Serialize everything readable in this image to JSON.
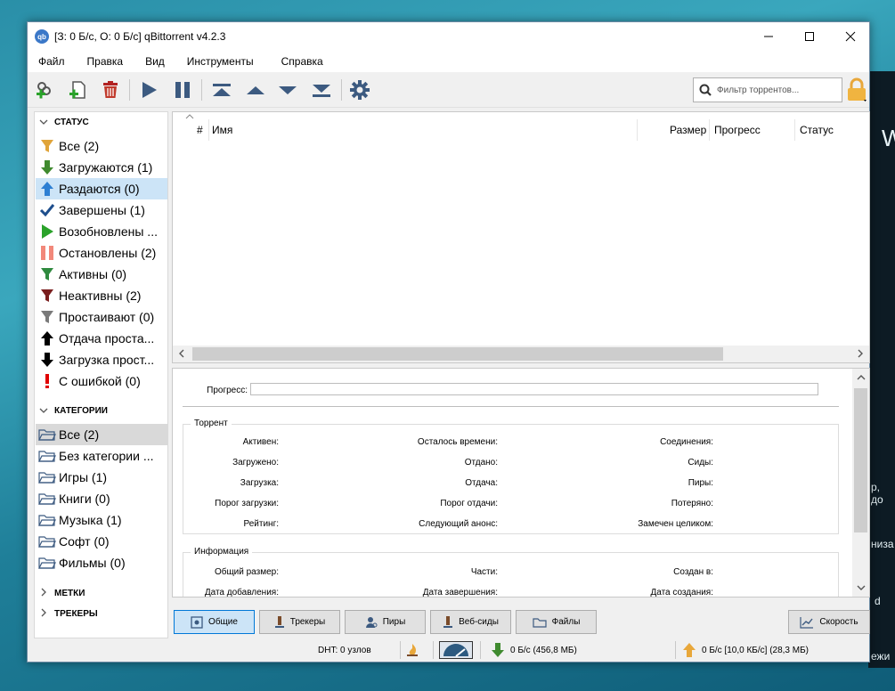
{
  "window": {
    "title": "[З: 0 Б/с, О: 0 Б/с] qBittorrent v4.2.3",
    "app_icon": "qb"
  },
  "menu": [
    "Файл",
    "Правка",
    "Вид",
    "Инструменты",
    "Справка"
  ],
  "toolbar": {
    "search_placeholder": "Фильтр торрентов..."
  },
  "sidebar": {
    "status_header": "СТАТУС",
    "status_items": [
      {
        "label": "Все (2)",
        "icon": "filter-icon",
        "color": "#e0a43a"
      },
      {
        "label": "Загружаются (1)",
        "icon": "arrow-down-icon",
        "color": "#3f8a2f"
      },
      {
        "label": "Раздаются (0)",
        "icon": "arrow-up-icon",
        "color": "#2d7fd3"
      },
      {
        "label": "Завершены (1)",
        "icon": "checkmark-icon",
        "color": "#1e4e8c"
      },
      {
        "label": "Возобновлены ...",
        "icon": "play-icon",
        "color": "#2aa22a"
      },
      {
        "label": "Остановлены (2)",
        "icon": "pause-icon",
        "color": "#f2887a"
      },
      {
        "label": "Активны (0)",
        "icon": "filter-icon",
        "color": "#2f8a3f"
      },
      {
        "label": "Неактивны (2)",
        "icon": "filter-icon",
        "color": "#7a1e1e"
      },
      {
        "label": "Простаивают (0)",
        "icon": "filter-icon",
        "color": "#7a7a7a"
      },
      {
        "label": "Отдача проста...",
        "icon": "arrow-up-icon",
        "color": "#000000"
      },
      {
        "label": "Загрузка прост...",
        "icon": "arrow-down-icon",
        "color": "#000000"
      },
      {
        "label": "С ошибкой (0)",
        "icon": "exclamation-icon",
        "color": "#e00000"
      }
    ],
    "categories_header": "КАТЕГОРИИ",
    "category_items": [
      "Все (2)",
      "Без категории ...",
      "Игры (1)",
      "Книги (0)",
      "Музыка (1)",
      "Софт (0)",
      "Фильмы (0)"
    ],
    "tags_header": "МЕТКИ",
    "trackers_header": "ТРЕКЕРЫ"
  },
  "torrent_list": {
    "columns": [
      "#",
      "Имя",
      "Размер",
      "Прогресс",
      "Статус"
    ]
  },
  "details": {
    "progress_label": "Прогресс:",
    "torrent_group": "Торрент",
    "torrent_fields": [
      [
        "Активен:",
        "Осталось времени:",
        "Соединения:"
      ],
      [
        "Загружено:",
        "Отдано:",
        "Сиды:"
      ],
      [
        "Загрузка:",
        "Отдача:",
        "Пиры:"
      ],
      [
        "Порог загрузки:",
        "Порог отдачи:",
        "Потеряно:"
      ],
      [
        "Рейтинг:",
        "Следующий анонс:",
        "Замечен целиком:"
      ]
    ],
    "info_group": "Информация",
    "info_fields": [
      [
        "Общий размер:",
        "Части:",
        "Создан в:"
      ],
      [
        "Дата добавления:",
        "Дата завершения:",
        "Дата создания:"
      ]
    ]
  },
  "tabs": [
    "Общие",
    "Трекеры",
    "Пиры",
    "Веб-сиды",
    "Файлы"
  ],
  "speed_button": "Скорость",
  "statusbar": {
    "dht": "DHT: 0 узлов",
    "download": "0 Б/с (456,8 МБ)",
    "upload": "0 Б/с [10,0 КБ/с] (28,3 МБ)"
  },
  "desktop_fragments": [
    "W",
    "р, до",
    "низа",
    "d",
    "ежи"
  ]
}
